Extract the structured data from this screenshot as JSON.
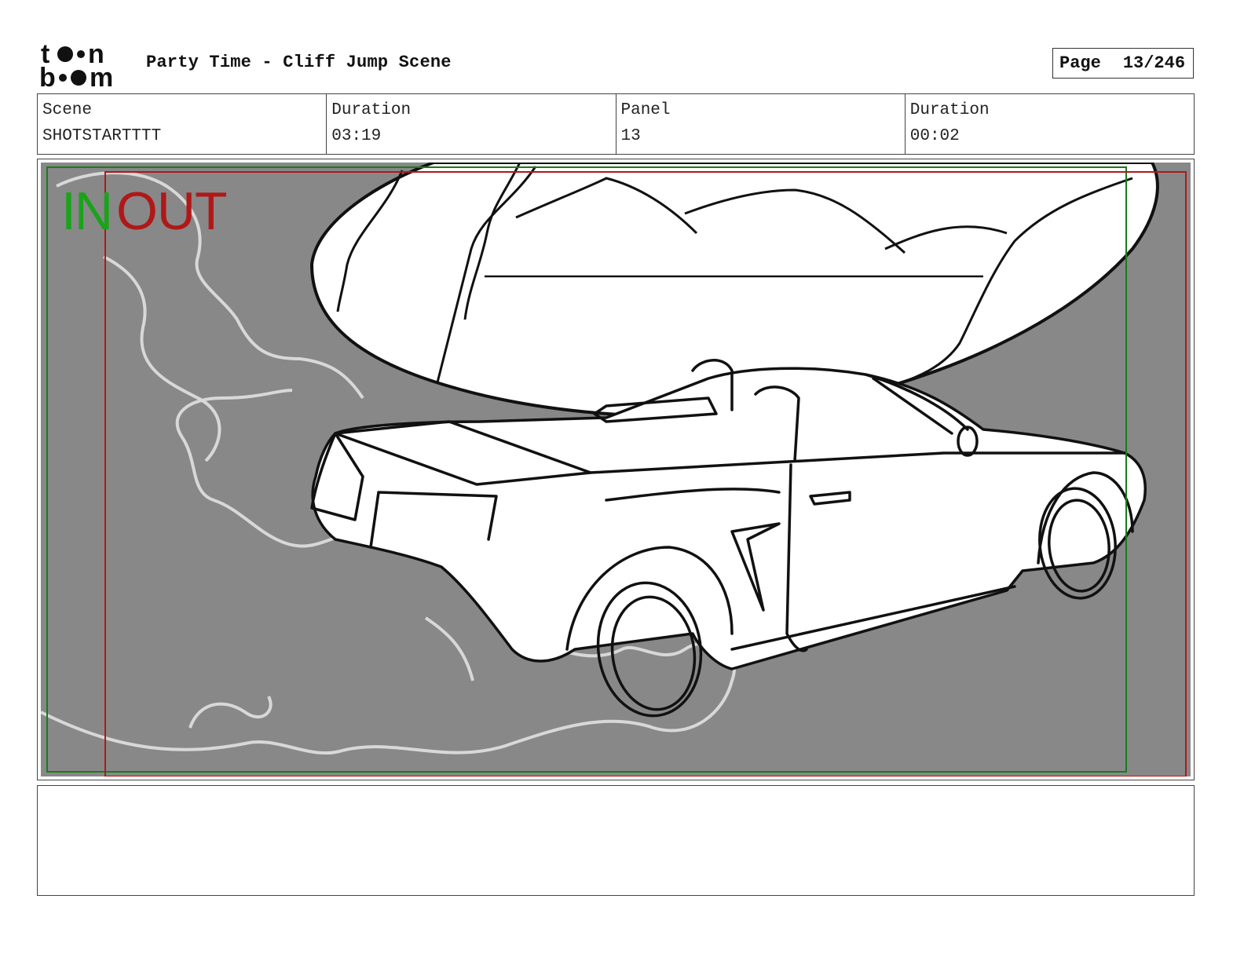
{
  "logo": {
    "line1": "toon",
    "line2": "boom",
    "icon": "toon-boom-logo"
  },
  "header": {
    "title": "Party Time - Cliff Jump Scene",
    "page_label": "Page",
    "page_value": "13/246"
  },
  "info": [
    {
      "label": "Scene",
      "value": "SHOTSTARTTTT"
    },
    {
      "label": "Duration",
      "value": "03:19"
    },
    {
      "label": "Panel",
      "value": "13"
    },
    {
      "label": "Duration",
      "value": "00:02"
    }
  ],
  "panel": {
    "in_marker": "IN",
    "out_marker": "OUT",
    "in_color": "#1aa31a",
    "out_color": "#b01818",
    "background_color": "#888888",
    "sketch_subject": "car-drifting-sketch"
  },
  "notes": {
    "text": ""
  }
}
